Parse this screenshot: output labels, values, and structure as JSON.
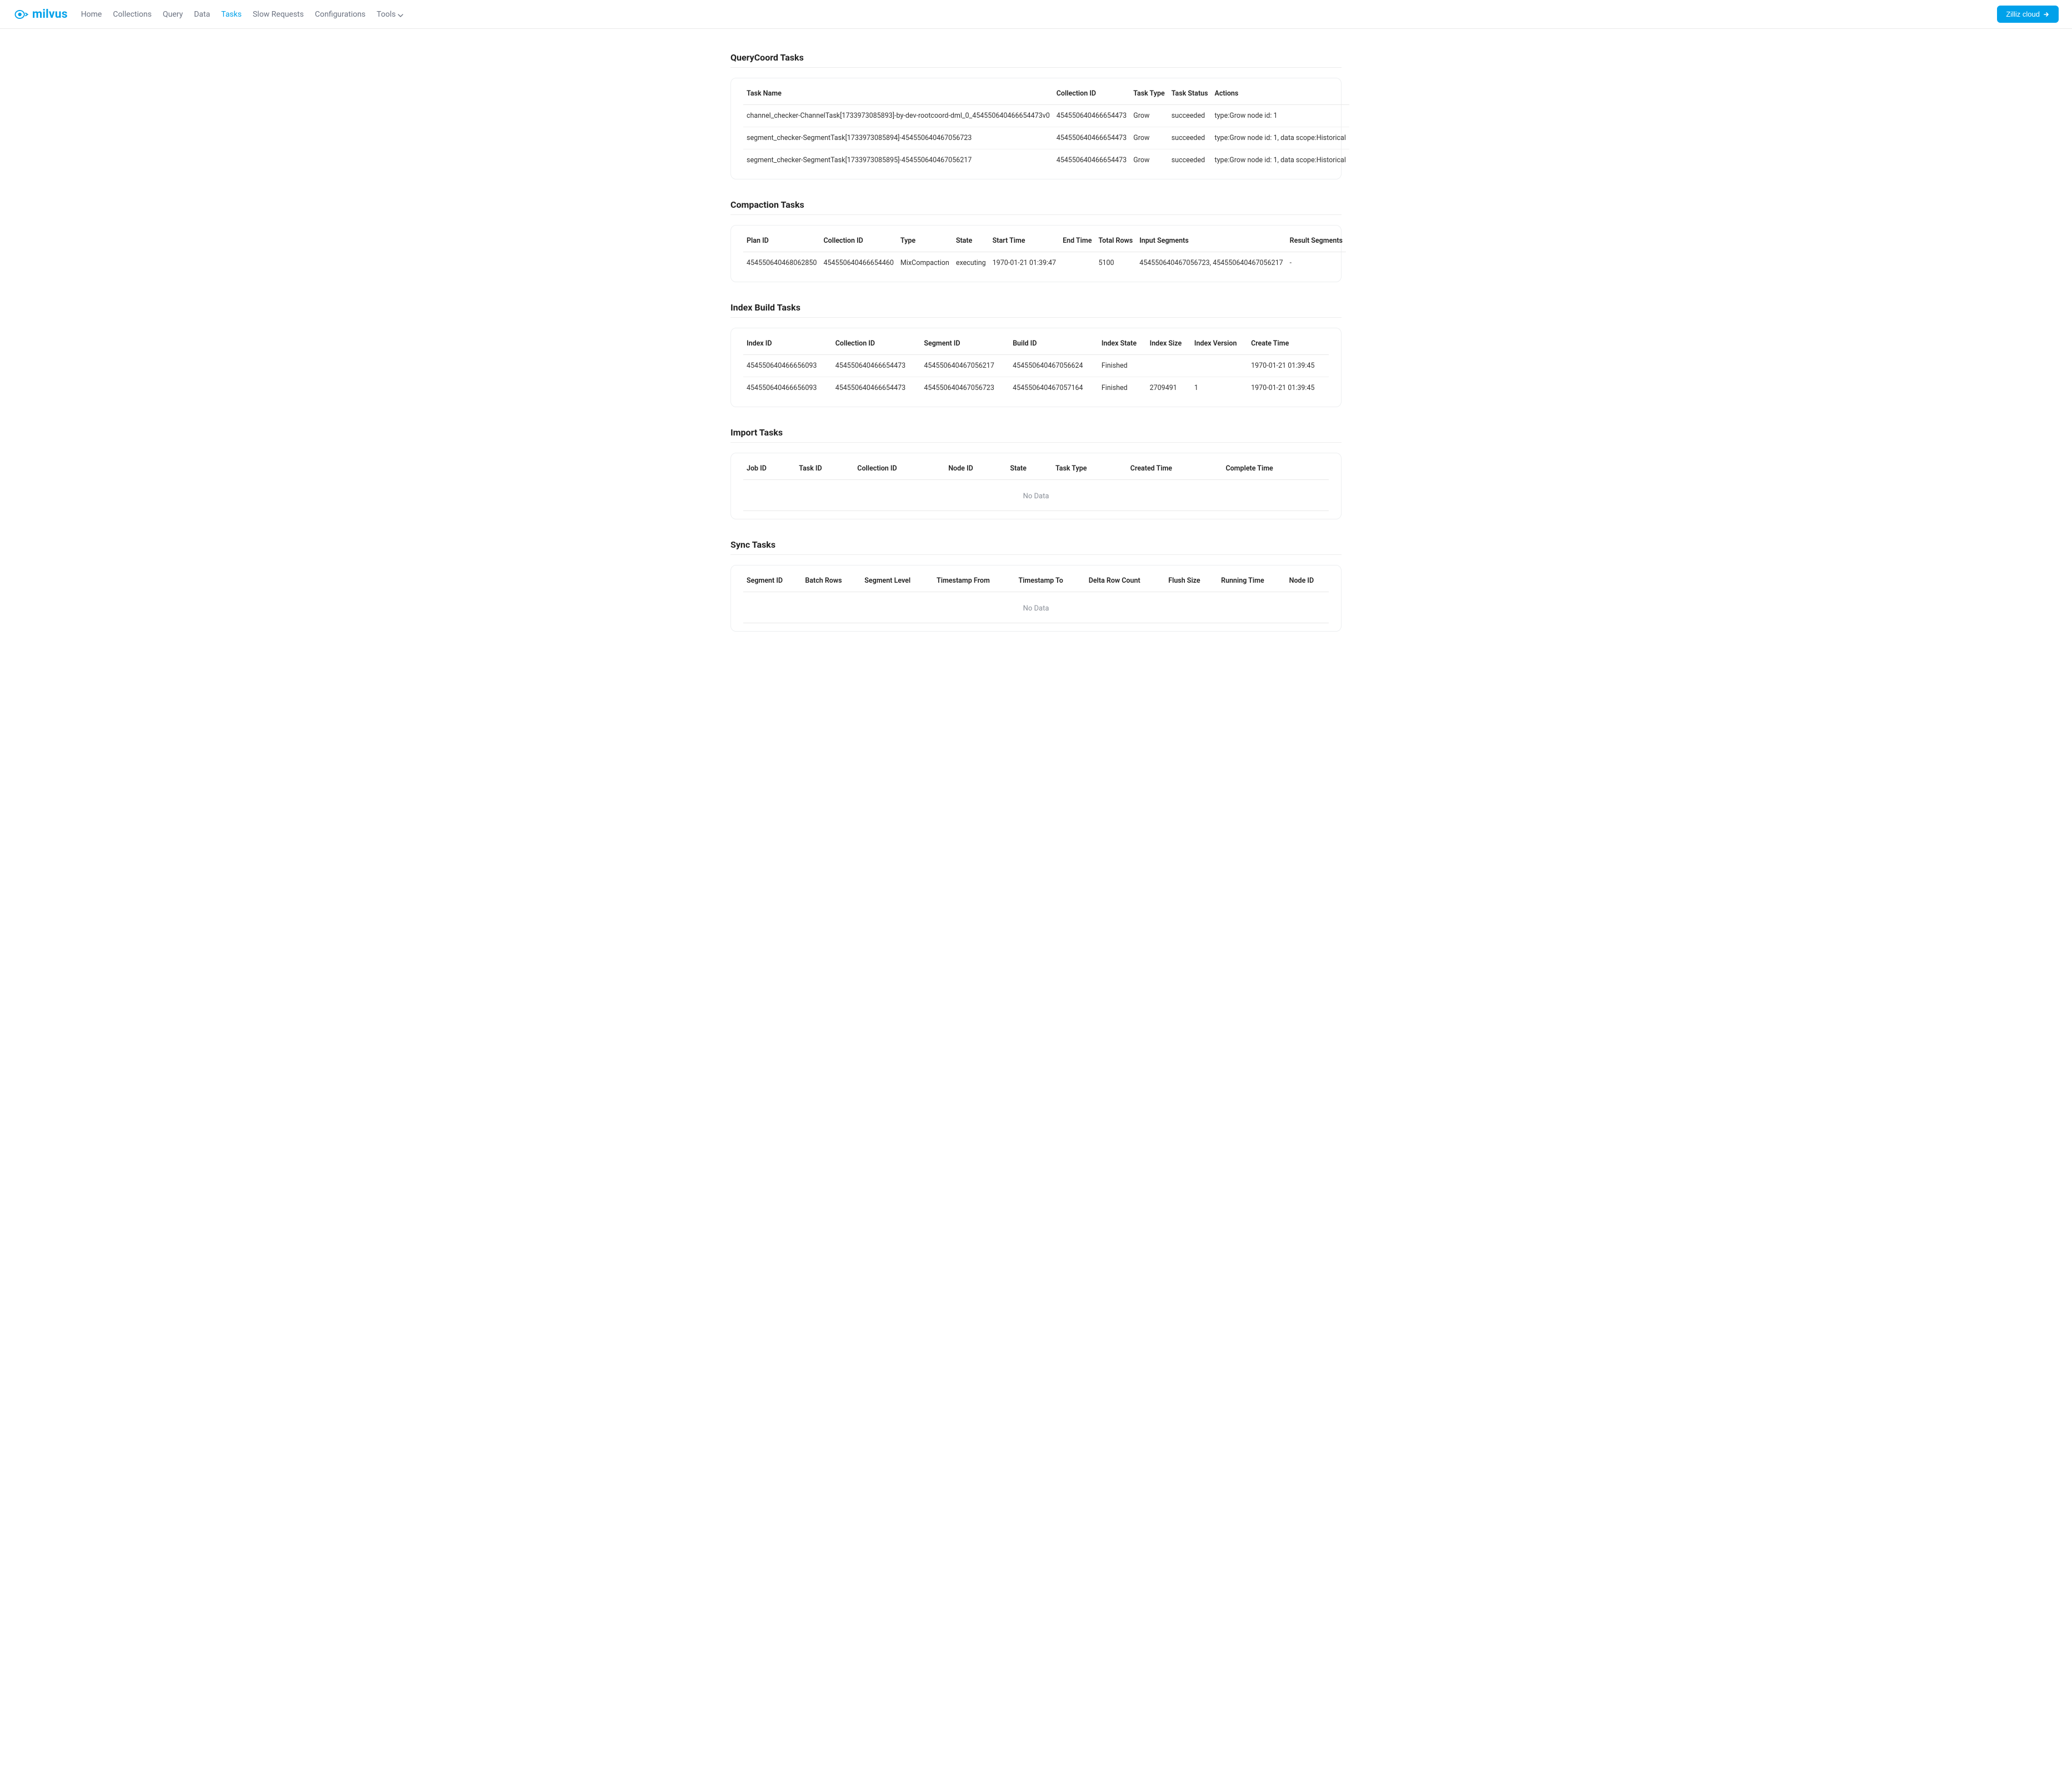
{
  "brand": {
    "name": "milvus"
  },
  "nav": {
    "items": [
      {
        "label": "Home"
      },
      {
        "label": "Collections"
      },
      {
        "label": "Query"
      },
      {
        "label": "Data"
      },
      {
        "label": "Tasks",
        "active": true
      },
      {
        "label": "Slow Requests"
      },
      {
        "label": "Configurations"
      },
      {
        "label": "Tools",
        "caret": true
      }
    ],
    "cloud_button": "Zilliz cloud"
  },
  "no_data_label": "No Data",
  "sections": {
    "querycoord": {
      "title": "QueryCoord Tasks",
      "headers": [
        "Task Name",
        "Collection ID",
        "Task Type",
        "Task Status",
        "Actions"
      ],
      "rows": [
        {
          "c0": "channel_checker-ChannelTask[1733973085893]-by-dev-rootcoord-dml_0_454550640466654473v0",
          "c1": "454550640466654473",
          "c2": "Grow",
          "c3": "succeeded",
          "c4": "type:Grow node id: 1"
        },
        {
          "c0": "segment_checker-SegmentTask[1733973085894]-454550640467056723",
          "c1": "454550640466654473",
          "c2": "Grow",
          "c3": "succeeded",
          "c4": "type:Grow node id: 1, data scope:Historical"
        },
        {
          "c0": "segment_checker-SegmentTask[1733973085895]-454550640467056217",
          "c1": "454550640466654473",
          "c2": "Grow",
          "c3": "succeeded",
          "c4": "type:Grow node id: 1, data scope:Historical"
        }
      ]
    },
    "compaction": {
      "title": "Compaction Tasks",
      "headers": [
        "Plan ID",
        "Collection ID",
        "Type",
        "State",
        "Start Time",
        "End Time",
        "Total Rows",
        "Input Segments",
        "Result Segments"
      ],
      "rows": [
        {
          "c0": "454550640468062850",
          "c1": "454550640466654460",
          "c2": "MixCompaction",
          "c3": "executing",
          "c4": "1970-01-21 01:39:47",
          "c5": "",
          "c6": "5100",
          "c7": "454550640467056723, 454550640467056217",
          "c8": "-"
        }
      ]
    },
    "indexbuild": {
      "title": "Index Build Tasks",
      "headers": [
        "Index ID",
        "Collection ID",
        "Segment ID",
        "Build ID",
        "Index State",
        "Index Size",
        "Index Version",
        "Create Time"
      ],
      "rows": [
        {
          "c0": "454550640466656093",
          "c1": "454550640466654473",
          "c2": "454550640467056217",
          "c3": "454550640467056624",
          "c4": "Finished",
          "c5": "",
          "c6": "",
          "c7": "1970-01-21 01:39:45"
        },
        {
          "c0": "454550640466656093",
          "c1": "454550640466654473",
          "c2": "454550640467056723",
          "c3": "454550640467057164",
          "c4": "Finished",
          "c5": "2709491",
          "c6": "1",
          "c7": "1970-01-21 01:39:45"
        }
      ]
    },
    "import": {
      "title": "Import Tasks",
      "headers": [
        "Job ID",
        "Task ID",
        "Collection ID",
        "Node ID",
        "State",
        "Task Type",
        "Created Time",
        "Complete Time"
      ],
      "rows": []
    },
    "sync": {
      "title": "Sync Tasks",
      "headers": [
        "Segment ID",
        "Batch Rows",
        "Segment Level",
        "Timestamp From",
        "Timestamp To",
        "Delta Row Count",
        "Flush Size",
        "Running Time",
        "Node ID"
      ],
      "rows": []
    }
  }
}
